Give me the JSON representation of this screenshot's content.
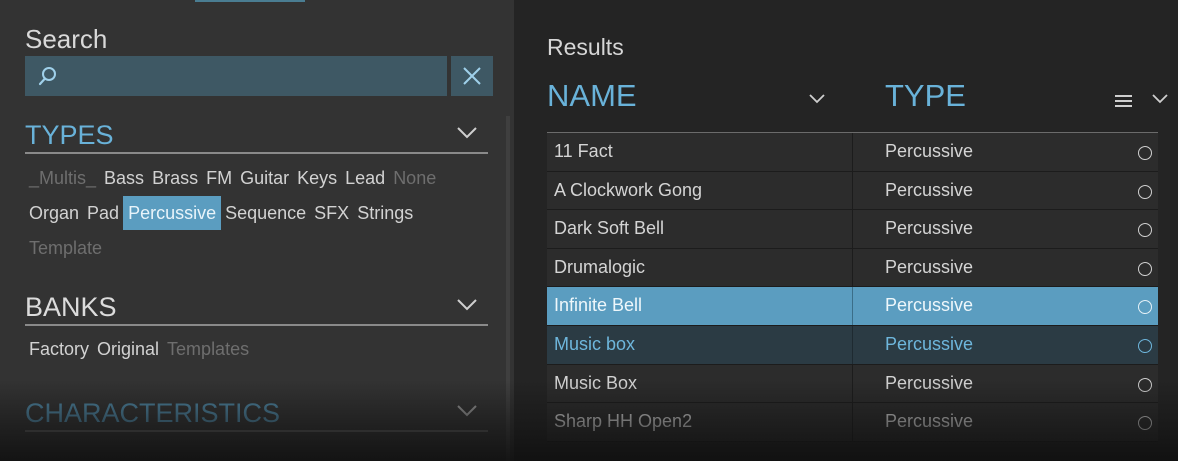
{
  "search": {
    "title": "Search",
    "value": "",
    "placeholder": ""
  },
  "types": {
    "title": "TYPES",
    "row1": [
      {
        "label": "_Multis_",
        "state": "dim"
      },
      {
        "label": "Bass",
        "state": "normal"
      },
      {
        "label": "Brass",
        "state": "normal"
      },
      {
        "label": "FM",
        "state": "normal"
      },
      {
        "label": "Guitar",
        "state": "normal"
      },
      {
        "label": "Keys",
        "state": "normal"
      },
      {
        "label": "Lead",
        "state": "normal"
      },
      {
        "label": "None",
        "state": "dim"
      }
    ],
    "row2": [
      {
        "label": "Organ",
        "state": "normal"
      },
      {
        "label": "Pad",
        "state": "normal"
      },
      {
        "label": "Percussive",
        "state": "selected"
      },
      {
        "label": "Sequence",
        "state": "normal"
      },
      {
        "label": "SFX",
        "state": "normal"
      },
      {
        "label": "Strings",
        "state": "normal"
      }
    ],
    "row3": [
      {
        "label": "Template",
        "state": "dim"
      }
    ]
  },
  "banks": {
    "title": "BANKS",
    "items": [
      {
        "label": "Factory",
        "state": "normal"
      },
      {
        "label": "Original",
        "state": "normal"
      },
      {
        "label": "Templates",
        "state": "dim"
      }
    ]
  },
  "characteristics": {
    "title": "CHARACTERISTICS"
  },
  "results": {
    "title": "Results",
    "columns": {
      "name": "NAME",
      "type": "TYPE"
    },
    "rows": [
      {
        "name": "11 Fact",
        "type": "Percussive",
        "state": "normal"
      },
      {
        "name": "A Clockwork Gong",
        "type": "Percussive",
        "state": "normal"
      },
      {
        "name": "Dark Soft Bell",
        "type": "Percussive",
        "state": "normal"
      },
      {
        "name": "Drumalogic",
        "type": "Percussive",
        "state": "normal"
      },
      {
        "name": "Infinite Bell",
        "type": "Percussive",
        "state": "highlighted"
      },
      {
        "name": "Music box",
        "type": "Percussive",
        "state": "current"
      },
      {
        "name": "Music Box",
        "type": "Percussive",
        "state": "normal"
      },
      {
        "name": "Sharp HH Open2",
        "type": "Percussive",
        "state": "normal"
      }
    ]
  },
  "colors": {
    "accent": "#69b2d9",
    "selection": "#5b9dc0",
    "panel_left": "#333333",
    "panel_right": "#242424"
  }
}
